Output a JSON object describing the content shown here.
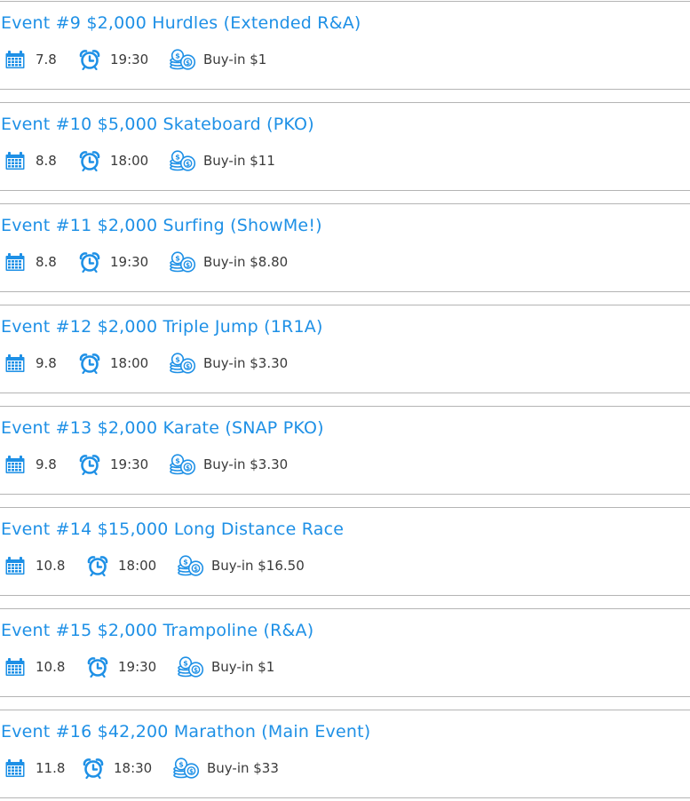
{
  "accent_color": "#1e90e6",
  "icons": {
    "date": "calendar-icon",
    "time": "alarm-clock-icon",
    "buyin": "coins-icon"
  },
  "events": [
    {
      "title": "Event #9 $2,000 Hurdles (Extended R&A)",
      "date": "7.8",
      "time": "19:30",
      "buyin": "Buy-in $1"
    },
    {
      "title": "Event #10 $5,000 Skateboard (PKO)",
      "date": "8.8",
      "time": "18:00",
      "buyin": "Buy-in $11"
    },
    {
      "title": "Event #11 $2,000 Surfing (ShowMe!)",
      "date": "8.8",
      "time": "19:30",
      "buyin": "Buy-in $8.80"
    },
    {
      "title": "Event #12 $2,000 Triple Jump (1R1A)",
      "date": "9.8",
      "time": "18:00",
      "buyin": "Buy-in $3.30"
    },
    {
      "title": "Event #13 $2,000 Karate (SNAP PKO)",
      "date": "9.8",
      "time": "19:30",
      "buyin": "Buy-in $3.30"
    },
    {
      "title": "Event #14 $15,000 Long Distance Race",
      "date": "10.8",
      "time": "18:00",
      "buyin": "Buy-in $16.50"
    },
    {
      "title": "Event #15 $2,000 Trampoline (R&A)",
      "date": "10.8",
      "time": "19:30",
      "buyin": "Buy-in $1"
    },
    {
      "title": "Event #16 $42,200 Marathon (Main Event)",
      "date": "11.8",
      "time": "18:30",
      "buyin": "Buy-in $33"
    }
  ]
}
